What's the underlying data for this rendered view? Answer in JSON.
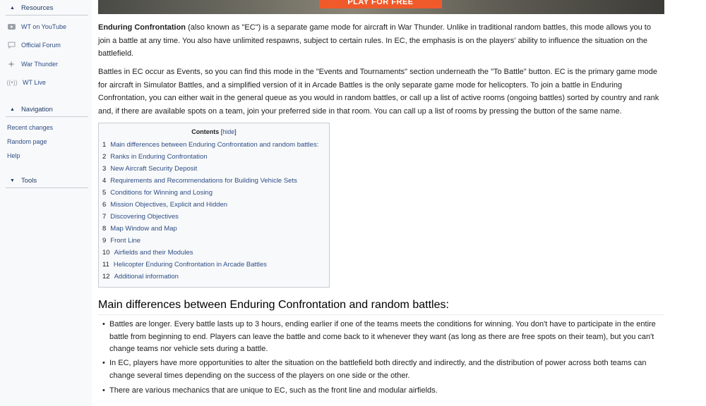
{
  "sidebar": {
    "resources": {
      "title": "Resources",
      "items": [
        {
          "label": "WT on YouTube",
          "icon": "youtube-icon"
        },
        {
          "label": "Official Forum",
          "icon": "forum-icon"
        },
        {
          "label": "War Thunder",
          "icon": "war-thunder-icon"
        },
        {
          "label": "WT Live",
          "icon": "live-icon"
        }
      ]
    },
    "navigation": {
      "title": "Navigation",
      "items": [
        "Recent changes",
        "Random page",
        "Help"
      ]
    },
    "tools": {
      "title": "Tools"
    }
  },
  "banner": {
    "button_label": "PLAY FOR FREE"
  },
  "intro": {
    "p1_bold": "Enduring Confrontation",
    "p1_rest": " (also known as \"EC\") is a separate game mode for aircraft in War Thunder. Unlike in traditional random battles, this mode allows you to join a battle at any time. You also have unlimited respawns, subject to certain rules. In EC, the emphasis is on the players' ability to influence the situation on the battlefield.",
    "p2": "Battles in EC occur as Events, so you can find this mode in the \"Events and Tournaments\" section underneath the \"To Battle\" button. EC is the primary game mode for aircraft in Simulator Battles, and a simplified version of it in Arcade Battles is the only separate game mode for helicopters. To join a battle in Enduring Confrontation, you can either wait in the general queue as you would in random battles, or call up a list of active rooms (ongoing battles) sorted by country and rank and, if there are available spots on a team, join your preferred side in that room. You can call up a list of rooms by pressing the button of the same name."
  },
  "toc": {
    "title": "Contents",
    "hide_open": "[",
    "hide": "hide",
    "hide_close": "]",
    "items": [
      {
        "num": "1",
        "label": "Main differences between Enduring Confrontation and random battles:"
      },
      {
        "num": "2",
        "label": "Ranks in Enduring Confrontation"
      },
      {
        "num": "3",
        "label": "New Aircraft Security Deposit"
      },
      {
        "num": "4",
        "label": "Requirements and Recommendations for Building Vehicle Sets"
      },
      {
        "num": "5",
        "label": "Conditions for Winning and Losing"
      },
      {
        "num": "6",
        "label": "Mission Objectives, Explicit and Hidden"
      },
      {
        "num": "7",
        "label": "Discovering Objectives"
      },
      {
        "num": "8",
        "label": "Map Window and Map"
      },
      {
        "num": "9",
        "label": "Front Line"
      },
      {
        "num": "10",
        "label": "Airfields and their Modules"
      },
      {
        "num": "11",
        "label": "Helicopter Enduring Confrontation in Arcade Battles"
      },
      {
        "num": "12",
        "label": "Additional information"
      }
    ]
  },
  "section": {
    "heading": "Main differences between Enduring Confrontation and random battles:",
    "bullets": [
      "Battles are longer. Every battle lasts up to 3 hours, ending earlier if one of the teams meets the conditions for winning. You don't have to participate in the entire battle from beginning to end. Players can leave the battle and come back to it whenever they want (as long as there are free spots on their team), but you can't change teams nor vehicle sets during a battle.",
      "In EC, players have more opportunities to alter the situation on the battlefield both directly and indirectly, and the distribution of power across both teams can change several times depending on the success of the players on one side or the other.",
      "There are various mechanics that are unique to EC, such as the front line and modular airfields."
    ]
  }
}
